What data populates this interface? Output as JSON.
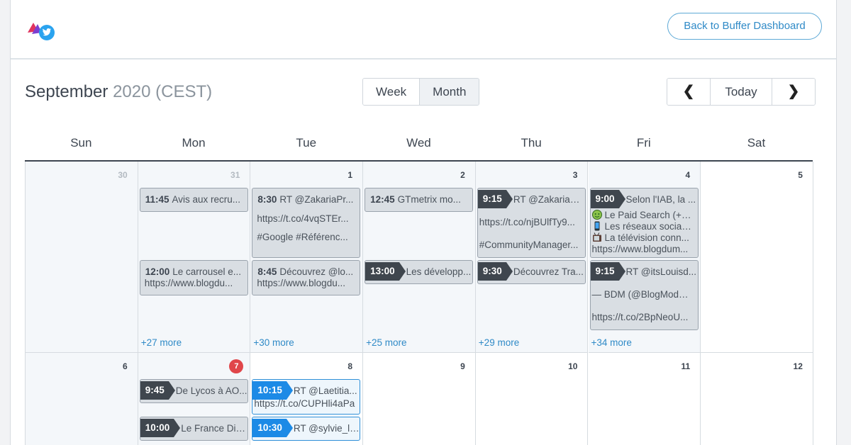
{
  "header": {
    "back_button": "Back to Buffer Dashboard"
  },
  "calendar": {
    "month": "September",
    "year_tz": "2020 (CEST)",
    "view_toggle": {
      "week": "Week",
      "month": "Month",
      "active": "Month"
    },
    "nav": {
      "prev": "❮",
      "today": "Today",
      "next": "❯"
    },
    "weekdays": [
      "Sun",
      "Mon",
      "Tue",
      "Wed",
      "Thu",
      "Fri",
      "Sat"
    ],
    "week1": {
      "days": [
        "30",
        "31",
        "1",
        "2",
        "3",
        "4",
        "5"
      ],
      "mon_post1": {
        "time": "11:45",
        "text": "Avis aux recru..."
      },
      "mon_post2": {
        "time": "12:00",
        "text": "Le carrousel e...",
        "line2": "https://www.blogdu..."
      },
      "mon_more": "+27 more",
      "tue_post1": {
        "time": "8:30",
        "text": "RT @ZakariaPr...",
        "line2": "https://t.co/4vqSTEr...",
        "line3": "#Google #Référenc..."
      },
      "tue_post2": {
        "time": "8:45",
        "text": "Découvrez @lo...",
        "line2": "https://www.blogdu..."
      },
      "tue_more": "+30 more",
      "wed_post1": {
        "time": "12:45",
        "text": "GTmetrix mo..."
      },
      "wed_post2": {
        "time": "13:00",
        "text": "Les développ..."
      },
      "wed_more": "+25 more",
      "thu_post1": {
        "time": "9:15",
        "text": "RT @ZakariaPr...",
        "line2": "https://t.co/njBUlfTy9...",
        "line3": "#CommunityManager..."
      },
      "thu_post2": {
        "time": "9:30",
        "text": "Découvrez Tra..."
      },
      "thu_more": "+29 more",
      "fri_post1": {
        "time": "9:00",
        "text": "Selon l'IAB, la ...",
        "line2": "Le Paid Search (+ 2...",
        "line3": "Les réseaux sociau...",
        "line4": "La télévision conn...",
        "line5": "https://www.blogdum..."
      },
      "fri_post2": {
        "time": "9:15",
        "text": "RT @itsLouisd...",
        "line2": "— BDM (@BlogModer...",
        "line3": "https://t.co/2BpNeoU..."
      },
      "fri_more": "+34 more"
    },
    "week2": {
      "days": [
        "6",
        "7",
        "8",
        "9",
        "10",
        "11",
        "12"
      ],
      "mon_post1": {
        "time": "9:45",
        "text": "De Lycos à AO..."
      },
      "mon_post2": {
        "time": "10:00",
        "text": "Le France Dig..."
      },
      "tue_post1": {
        "time": "10:15",
        "text": "RT @Laetitia...",
        "line2": "https://t.co/CUPHli4aPa"
      },
      "tue_post2": {
        "time": "10:30",
        "text": "RT @sylvie_la..."
      }
    }
  },
  "colors": {
    "accent": "#2f8ac7",
    "today_badge": "#e0464a",
    "scheduled": "#1c8ae6",
    "sent_tag": "#3f464e"
  },
  "icons": {
    "logo": "buffer-twitter-logo",
    "prev": "chevron-left-icon",
    "next": "chevron-right-icon"
  }
}
